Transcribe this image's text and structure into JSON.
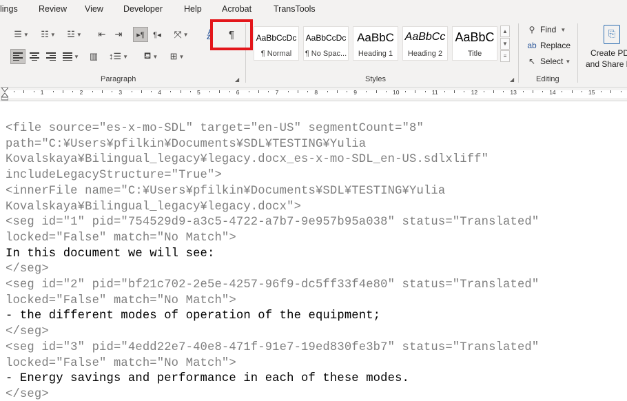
{
  "menu": {
    "tabs": [
      "lings",
      "Review",
      "View",
      "Developer",
      "Help",
      "Acrobat",
      "TransTools"
    ]
  },
  "ribbon": {
    "paragraph": {
      "label": "Paragraph",
      "show_marks_symbol": "¶",
      "show_marks_highlighted": true,
      "sort_label": "A\nZ"
    },
    "styles": {
      "label": "Styles",
      "tiles": [
        {
          "sample": "AaBbCcDc",
          "name": "¶ Normal"
        },
        {
          "sample": "AaBbCcDc",
          "name": "¶ No Spac..."
        },
        {
          "sample": "AaBbC",
          "name": "Heading 1"
        },
        {
          "sample": "AaBbCc",
          "name": "Heading 2"
        },
        {
          "sample": "AaBbC",
          "name": "Title"
        }
      ]
    },
    "editing": {
      "label": "Editing",
      "find": "Find",
      "replace": "Replace",
      "select": "Select"
    },
    "acrobat": {
      "line1": "Create PD",
      "line2": "and Share li"
    }
  },
  "ruler": {
    "numbers": [
      "1",
      "2",
      "3",
      "4",
      "5",
      "6",
      "7",
      "8",
      "9",
      "10",
      "11",
      "12",
      "13",
      "14",
      "15"
    ]
  },
  "document": {
    "lines": [
      {
        "text": "<file source=\"es-x-mo-SDL\" target=\"en-US\" segmentCount=\"8\"",
        "kind": "tag"
      },
      {
        "text": "path=\"C:¥Users¥pfilkin¥Documents¥SDL¥TESTING¥Yulia",
        "kind": "tag"
      },
      {
        "text": "Kovalskaya¥Bilingual_legacy¥legacy.docx_es-x-mo-SDL_en-US.sdlxliff\"",
        "kind": "tag"
      },
      {
        "text": "includeLegacyStructure=\"True\">",
        "kind": "tag"
      },
      {
        "text": "<innerFile name=\"C:¥Users¥pfilkin¥Documents¥SDL¥TESTING¥Yulia",
        "kind": "tag"
      },
      {
        "text": "Kovalskaya¥Bilingual_legacy¥legacy.docx\">",
        "kind": "tag"
      },
      {
        "text": "<seg id=\"1\" pid=\"754529d9-a3c5-4722-a7b7-9e957b95a038\" status=\"Translated\"",
        "kind": "tag"
      },
      {
        "text": "locked=\"False\" match=\"No Match\">",
        "kind": "tag"
      },
      {
        "text": "In this document we will see:",
        "kind": "content"
      },
      {
        "text": "</seg>",
        "kind": "tag"
      },
      {
        "text": "<seg id=\"2\" pid=\"bf21c702-2e5e-4257-96f9-dc5ff33f4e80\" status=\"Translated\"",
        "kind": "tag"
      },
      {
        "text": "locked=\"False\" match=\"No Match\">",
        "kind": "tag"
      },
      {
        "text": "- the different modes of operation of the equipment;",
        "kind": "content"
      },
      {
        "text": "</seg>",
        "kind": "tag"
      },
      {
        "text": "<seg id=\"3\" pid=\"4edd22e7-40e8-471f-91e7-19ed830fe3b7\" status=\"Translated\"",
        "kind": "tag"
      },
      {
        "text": "locked=\"False\" match=\"No Match\">",
        "kind": "tag"
      },
      {
        "text": "- Energy savings and performance in each of these modes.",
        "kind": "content"
      },
      {
        "text": "</seg>",
        "kind": "tag"
      }
    ]
  },
  "colors": {
    "highlight_box": "#e3161b",
    "tag_text": "#7f7f7f",
    "content_text": "#000000",
    "ribbon_bg": "#f3f2f1"
  }
}
